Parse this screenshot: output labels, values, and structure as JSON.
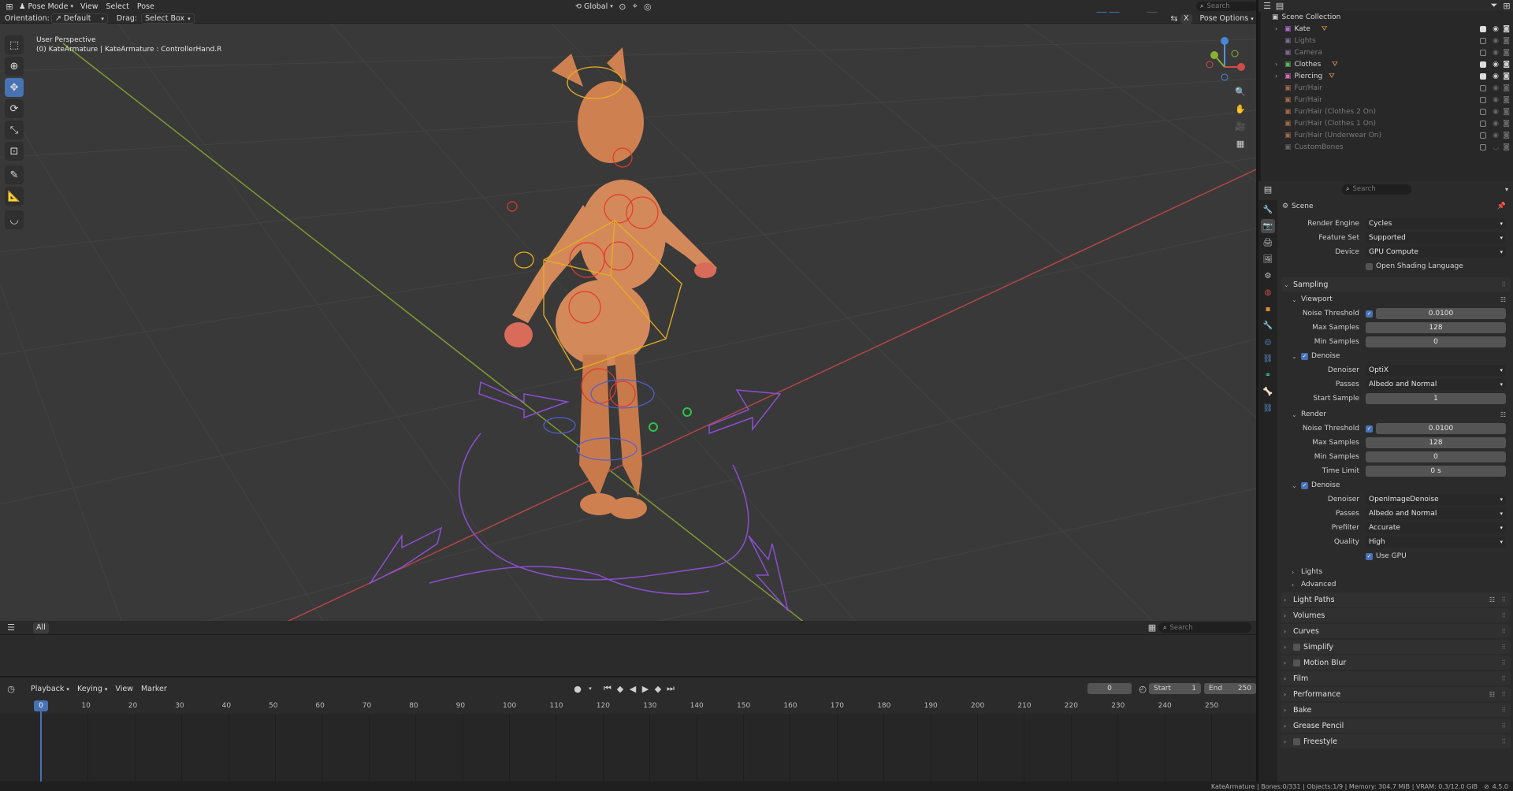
{
  "topbar": {
    "mode": "Pose Mode",
    "menus": [
      "View",
      "Select",
      "Pose"
    ],
    "transform_orientation": "Global",
    "search_placeholder": "Search"
  },
  "tool_settings": {
    "orientation_label": "Orientation:",
    "orientation_value": "Default",
    "drag_label": "Drag:",
    "drag_value": "Select Box",
    "pose_options": "Pose Options"
  },
  "viewport": {
    "view_name": "User Perspective",
    "object_info": "(0) KateArmature | KateArmature : ControllerHand.R",
    "bottom_tab": "All",
    "bottom_search_placeholder": "Search"
  },
  "outliner": {
    "root": "Scene Collection",
    "items": [
      {
        "label": "Kate",
        "enabled": true
      },
      {
        "label": "Lights",
        "enabled": false
      },
      {
        "label": "Camera",
        "enabled": false
      },
      {
        "label": "Clothes",
        "enabled": true
      },
      {
        "label": "Piercing",
        "enabled": true
      },
      {
        "label": "Fur/Hair",
        "enabled": false
      },
      {
        "label": "Fur/Hair",
        "enabled": false
      },
      {
        "label": "Fur/Hair (Clothes 2 On)",
        "enabled": false
      },
      {
        "label": "Fur/Hair (Clothes 1 On)",
        "enabled": false
      },
      {
        "label": "Fur/Hair (Underwear On)",
        "enabled": false
      },
      {
        "label": "CustomBones",
        "enabled": false
      }
    ]
  },
  "properties": {
    "search_placeholder": "Search",
    "context": "Scene",
    "render_engine": {
      "label": "Render Engine",
      "value": "Cycles"
    },
    "feature_set": {
      "label": "Feature Set",
      "value": "Supported"
    },
    "device": {
      "label": "Device",
      "value": "GPU Compute"
    },
    "osl": "Open Shading Language",
    "sampling": {
      "title": "Sampling",
      "viewport": {
        "title": "Viewport",
        "noise_threshold_label": "Noise Threshold",
        "noise_threshold": "0.0100",
        "max_samples_label": "Max Samples",
        "max_samples": "128",
        "min_samples_label": "Min Samples",
        "min_samples": "0",
        "denoise_title": "Denoise",
        "denoiser_label": "Denoiser",
        "denoiser": "OptiX",
        "passes_label": "Passes",
        "passes": "Albedo and Normal",
        "start_sample_label": "Start Sample",
        "start_sample": "1"
      },
      "render": {
        "title": "Render",
        "noise_threshold_label": "Noise Threshold",
        "noise_threshold": "0.0100",
        "max_samples_label": "Max Samples",
        "max_samples": "128",
        "min_samples_label": "Min Samples",
        "min_samples": "0",
        "time_limit_label": "Time Limit",
        "time_limit": "0 s",
        "denoise_title": "Denoise",
        "denoiser_label": "Denoiser",
        "denoiser": "OpenImageDenoise",
        "passes_label": "Passes",
        "passes": "Albedo and Normal",
        "prefilter_label": "Prefilter",
        "prefilter": "Accurate",
        "quality_label": "Quality",
        "quality": "High",
        "use_gpu": "Use GPU"
      },
      "lights": "Lights",
      "advanced": "Advanced"
    },
    "panels": [
      "Light Paths",
      "Volumes",
      "Curves",
      "Simplify",
      "Motion Blur",
      "Film",
      "Performance",
      "Bake",
      "Grease Pencil",
      "Freestyle"
    ]
  },
  "timeline": {
    "menus": [
      "Playback",
      "Keying",
      "View",
      "Marker"
    ],
    "current_frame": "0",
    "start_label": "Start",
    "start": "1",
    "end_label": "End",
    "end": "250",
    "ruler": [
      "0",
      "10",
      "20",
      "30",
      "40",
      "50",
      "60",
      "70",
      "80",
      "90",
      "100",
      "110",
      "120",
      "130",
      "140",
      "150",
      "160",
      "170",
      "180",
      "190",
      "200",
      "210",
      "220",
      "230",
      "240",
      "250"
    ]
  },
  "statusbar": {
    "text": "KateArmature | Bones:0/331 | Objects:1/9 | Memory: 304.7 MiB | VRAM: 0.3/12.0 GiB",
    "version": "4.5.0"
  },
  "colors": {
    "accent": "#4772b3",
    "viewport_bg": "#393939",
    "x_axis": "#c44a4a",
    "y_axis": "#8fa83c",
    "character": "#d98a55"
  }
}
